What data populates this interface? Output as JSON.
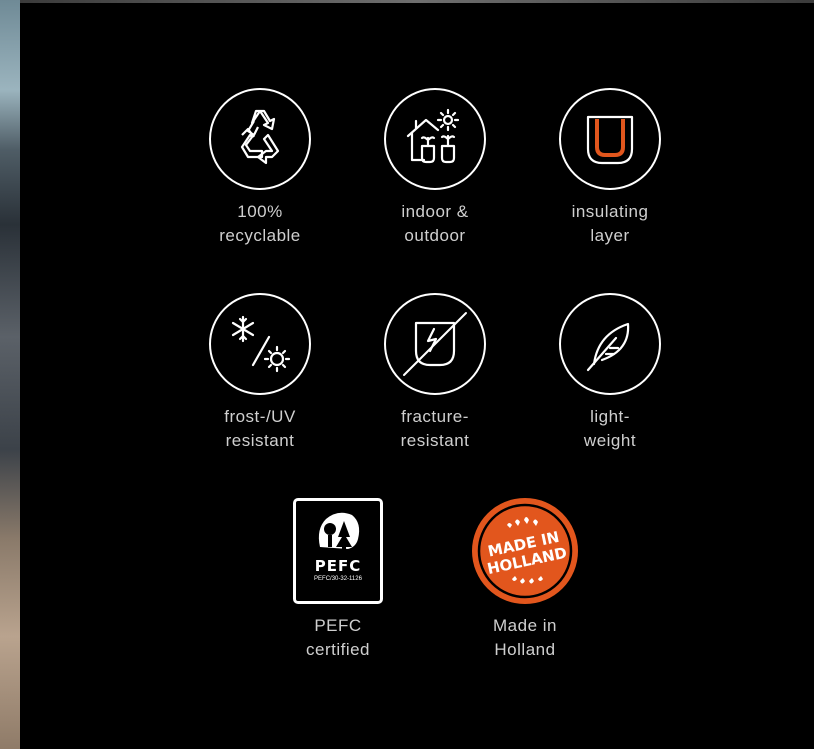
{
  "features": [
    {
      "icon": "recycle-icon",
      "line1": "100%",
      "line2": "recyclable"
    },
    {
      "icon": "indoor-outdoor-icon",
      "line1": "indoor &",
      "line2": "outdoor"
    },
    {
      "icon": "insulating-layer-icon",
      "line1": "insulating",
      "line2": "layer"
    },
    {
      "icon": "frost-uv-icon",
      "line1": "frost-/UV",
      "line2": "resistant"
    },
    {
      "icon": "fracture-resistant-icon",
      "line1": "fracture-",
      "line2": "resistant"
    },
    {
      "icon": "feather-icon",
      "line1": "light-",
      "line2": "weight"
    }
  ],
  "certifications": [
    {
      "icon": "pefc-logo",
      "line1": "PEFC",
      "line2": "certified",
      "badge_text": "PEFC",
      "badge_code": "PEFC/30-32-1126"
    },
    {
      "icon": "made-in-holland-seal",
      "line1": "Made in",
      "line2": "Holland",
      "badge_text": "MADE IN HOLLAND"
    }
  ],
  "colors": {
    "background": "#000000",
    "icon_stroke": "#ffffff",
    "accent": "#e2561d",
    "label": "#cfcfcf"
  }
}
